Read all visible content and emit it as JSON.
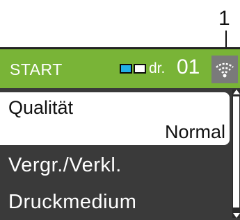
{
  "callout": {
    "number": "1"
  },
  "header": {
    "title": "START",
    "copies_label": "dr.",
    "copies_value": "01",
    "ink_colors": [
      "#22b0e8",
      "#ffffff"
    ],
    "background": "#79b437",
    "wifi_icon": "wifi-icon"
  },
  "menu": {
    "items": [
      {
        "label": "Qualität",
        "value": "Normal",
        "selected": true
      },
      {
        "label": "Vergr./Verkl."
      },
      {
        "label": "Druckmedium"
      }
    ]
  },
  "scrollbar": {
    "position": "top"
  }
}
